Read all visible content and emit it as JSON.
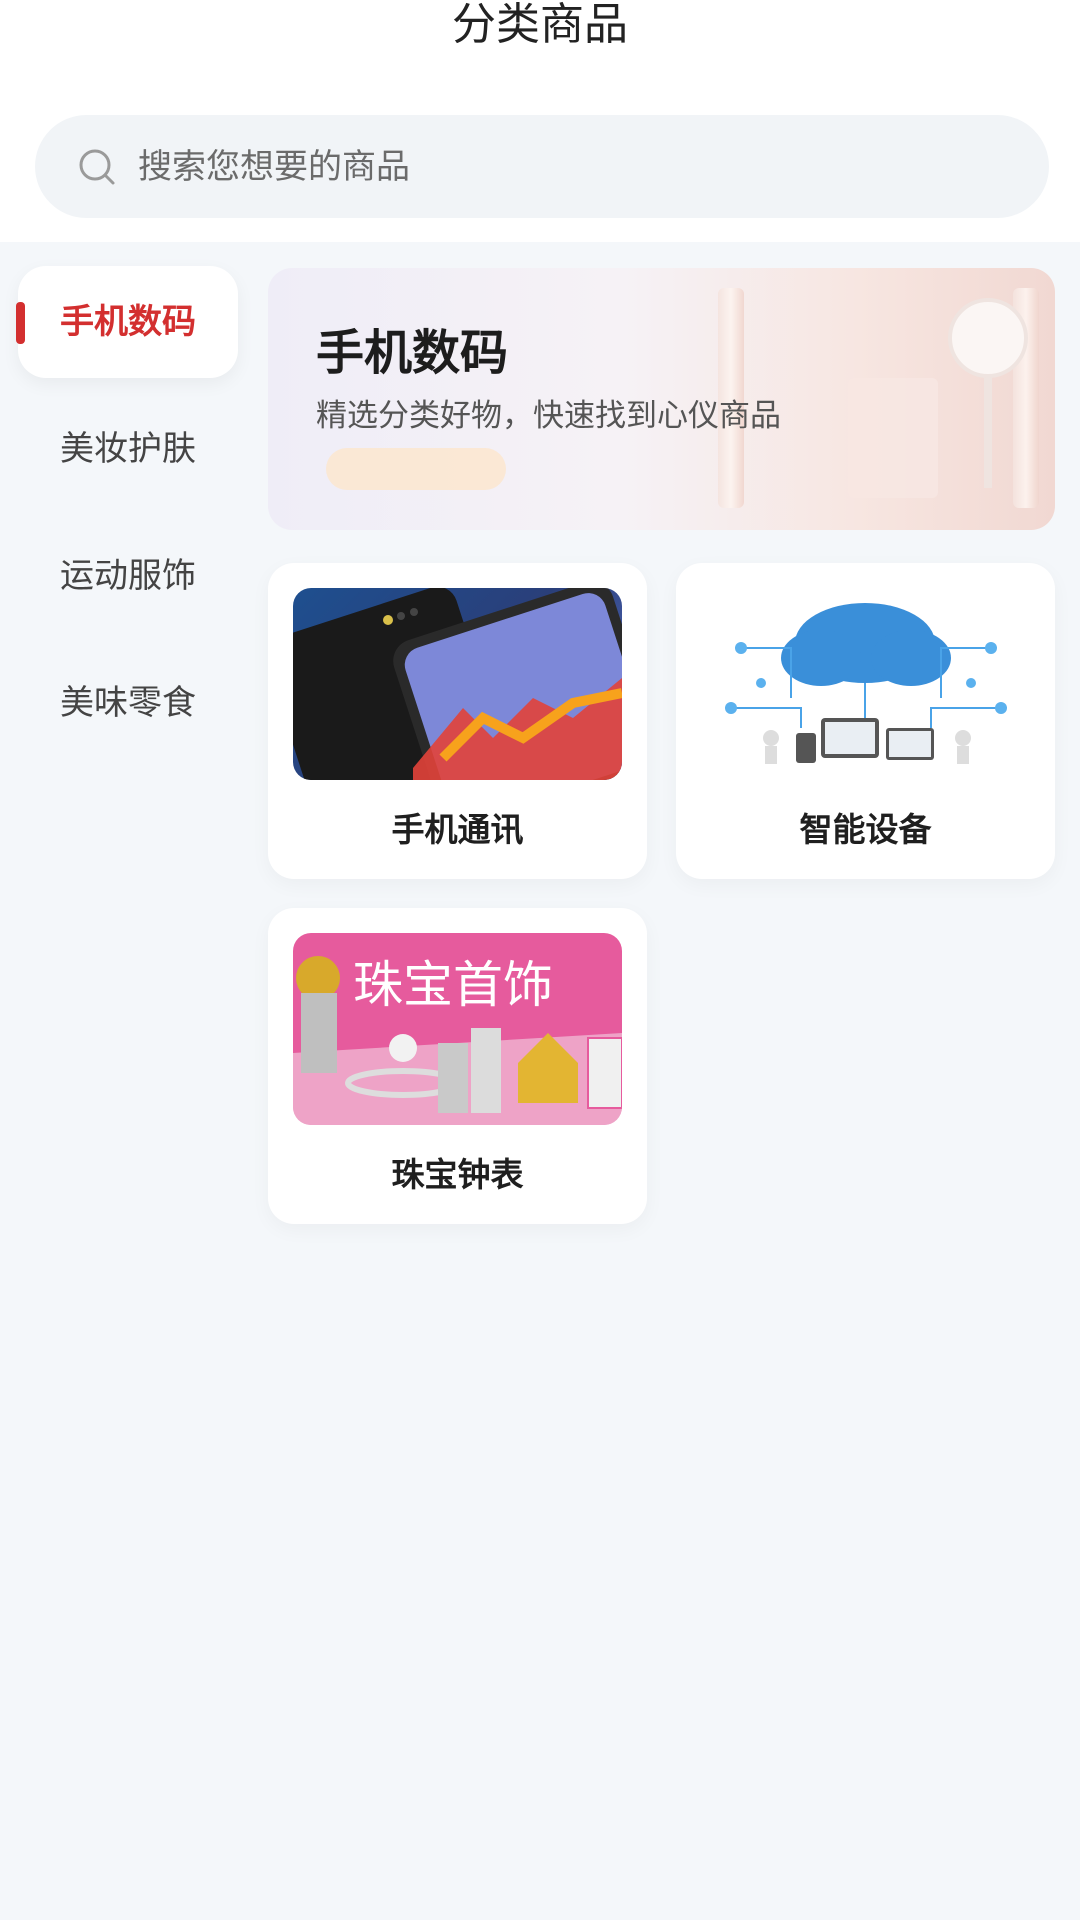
{
  "header": {
    "title": "分类商品"
  },
  "search": {
    "placeholder": "搜索您想要的商品"
  },
  "sidebar": {
    "items": [
      {
        "label": "手机数码",
        "active": true
      },
      {
        "label": "美妆护肤",
        "active": false
      },
      {
        "label": "运动服饰",
        "active": false
      },
      {
        "label": "美味零食",
        "active": false
      }
    ]
  },
  "banner": {
    "title": "手机数码",
    "subtitle": "精选分类好物，快速找到心仪商品"
  },
  "cards": [
    {
      "label": "手机通讯",
      "icon": "phone-image"
    },
    {
      "label": "智能设备",
      "icon": "smart-devices-image"
    },
    {
      "label": "珠宝钟表",
      "icon": "jewelry-image"
    }
  ],
  "images": {
    "jewelry_text": "珠宝首饰"
  },
  "colors": {
    "accent": "#d32f2f",
    "background": "#f4f7fa",
    "card": "#ffffff"
  }
}
